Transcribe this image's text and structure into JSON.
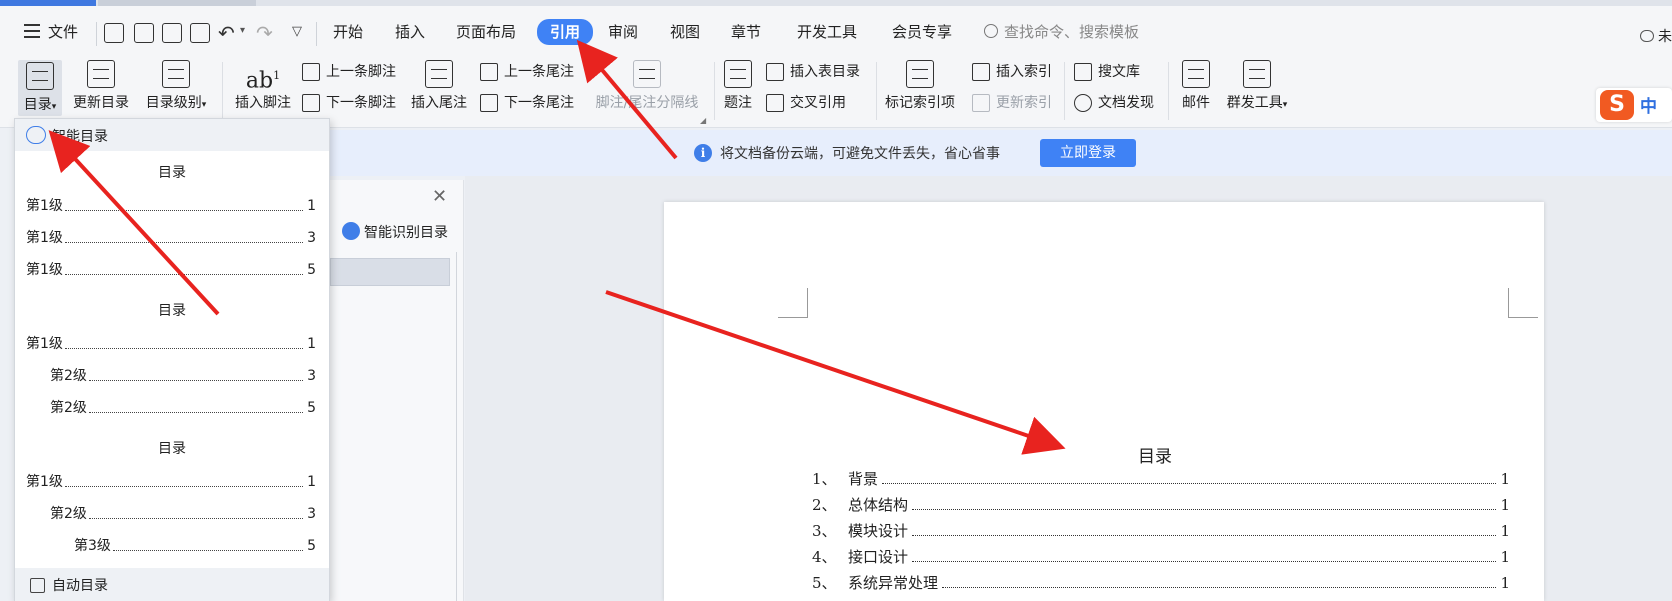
{
  "menu": {
    "file_label": "文件",
    "tabs": [
      "开始",
      "插入",
      "页面布局",
      "引用",
      "审阅",
      "视图",
      "章节",
      "开发工具",
      "会员专享"
    ],
    "active_tab": "引用",
    "search_placeholder": "查找命令、搜索模板",
    "right_text": "未"
  },
  "ribbon": {
    "toc": "目录",
    "update_toc": "更新目录",
    "toc_level": "目录级别",
    "insert_footnote": "插入脚注",
    "prev_footnote": "上一条脚注",
    "next_footnote": "下一条脚注",
    "insert_endnote": "插入尾注",
    "prev_endnote": "上一条尾注",
    "next_endnote": "下一条尾注",
    "footnote_sep": "脚注/尾注分隔线",
    "caption": "题注",
    "insert_table_toc": "插入表目录",
    "cross_ref": "交叉引用",
    "mark_index": "标记索引项",
    "insert_index": "插入索引",
    "update_index": "更新索引",
    "search_lib": "搜文库",
    "doc_discover": "文档发现",
    "mail": "邮件",
    "mass_send": "群发工具"
  },
  "ime": {
    "zh": "中"
  },
  "notify": {
    "text": "将文档备份云端，可避免文件丢失，省心省事",
    "login": "立即登录"
  },
  "nav": {
    "smart_toc": "智能识别目录"
  },
  "dropdown": {
    "smart_toc": "智能目录",
    "auto_toc": "自动目录",
    "styles": [
      {
        "title": "目录",
        "rows": [
          {
            "label": "第1级",
            "page": "1"
          },
          {
            "label": "第1级",
            "page": "3"
          },
          {
            "label": "第1级",
            "page": "5"
          }
        ]
      },
      {
        "title": "目录",
        "rows": [
          {
            "label": "第1级",
            "page": "1"
          },
          {
            "label": "第2级",
            "page": "3"
          },
          {
            "label": "第2级",
            "page": "5"
          }
        ]
      },
      {
        "title": "目录",
        "rows": [
          {
            "label": "第1级",
            "page": "1"
          },
          {
            "label": "第2级",
            "page": "3"
          },
          {
            "label": "第3级",
            "page": "5"
          }
        ]
      }
    ]
  },
  "document": {
    "toc_title": "目录",
    "entries": [
      {
        "num": "1、",
        "text": "背景",
        "page": "1"
      },
      {
        "num": "2、",
        "text": "总体结构",
        "page": "1"
      },
      {
        "num": "3、",
        "text": "模块设计",
        "page": "1"
      },
      {
        "num": "4、",
        "text": "接口设计",
        "page": "1"
      },
      {
        "num": "5、",
        "text": "系统异常处理",
        "page": "1"
      }
    ]
  },
  "colors": {
    "accent": "#3f82f5",
    "arrow": "#e8231f"
  }
}
